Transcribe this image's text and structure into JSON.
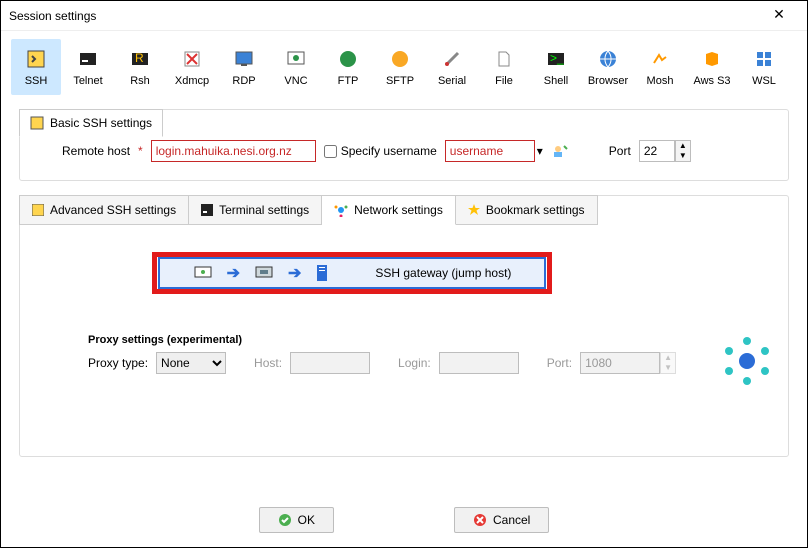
{
  "window": {
    "title": "Session settings"
  },
  "protocols": [
    {
      "id": "ssh",
      "label": "SSH",
      "selected": true
    },
    {
      "id": "telnet",
      "label": "Telnet"
    },
    {
      "id": "rsh",
      "label": "Rsh"
    },
    {
      "id": "xdmcp",
      "label": "Xdmcp"
    },
    {
      "id": "rdp",
      "label": "RDP"
    },
    {
      "id": "vnc",
      "label": "VNC"
    },
    {
      "id": "ftp",
      "label": "FTP"
    },
    {
      "id": "sftp",
      "label": "SFTP"
    },
    {
      "id": "serial",
      "label": "Serial"
    },
    {
      "id": "file",
      "label": "File"
    },
    {
      "id": "shell",
      "label": "Shell"
    },
    {
      "id": "browser",
      "label": "Browser"
    },
    {
      "id": "mosh",
      "label": "Mosh"
    },
    {
      "id": "awss3",
      "label": "Aws S3"
    },
    {
      "id": "wsl",
      "label": "WSL"
    }
  ],
  "basic": {
    "group_label": "Basic SSH settings",
    "remote_host_label": "Remote host",
    "required_mark": "*",
    "remote_host_value": "login.mahuika.nesi.org.nz",
    "specify_username_label": "Specify username",
    "specify_username_checked": false,
    "username_value": "username",
    "port_label": "Port",
    "port_value": "22"
  },
  "tabs": [
    {
      "id": "advanced",
      "label": "Advanced SSH settings",
      "icon": "tool-icon"
    },
    {
      "id": "terminal",
      "label": "Terminal settings",
      "icon": "terminal-icon"
    },
    {
      "id": "network",
      "label": "Network settings",
      "icon": "network-icon",
      "active": true
    },
    {
      "id": "bookmark",
      "label": "Bookmark settings",
      "icon": "star-icon"
    }
  ],
  "network": {
    "gateway_button_label": "SSH gateway (jump host)",
    "proxy": {
      "heading": "Proxy settings (experimental)",
      "type_label": "Proxy type:",
      "type_value": "None",
      "host_label": "Host:",
      "host_value": "",
      "login_label": "Login:",
      "login_value": "",
      "port_label": "Port:",
      "port_value": "1080"
    }
  },
  "footer": {
    "ok_label": "OK",
    "cancel_label": "Cancel"
  }
}
